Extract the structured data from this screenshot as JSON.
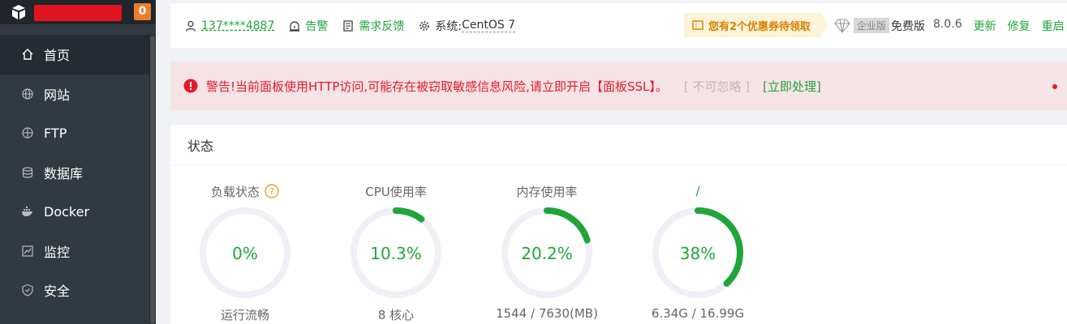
{
  "sidebar": {
    "badge": "0",
    "items": [
      {
        "label": "首页",
        "icon": "home-icon",
        "active": true
      },
      {
        "label": "网站",
        "icon": "globe-icon"
      },
      {
        "label": "FTP",
        "icon": "ftp-icon"
      },
      {
        "label": "数据库",
        "icon": "database-icon"
      },
      {
        "label": "Docker",
        "icon": "docker-icon"
      },
      {
        "label": "监控",
        "icon": "monitor-icon"
      },
      {
        "label": "安全",
        "icon": "shield-icon"
      }
    ]
  },
  "topbar": {
    "user": "137****4887",
    "alarm": "告警",
    "feedback": "需求反馈",
    "system_label": "系统:",
    "system_value": "CentOS 7",
    "coupon": "您有2个优惠券待领取",
    "enterprise": "企业版",
    "free": "免费版",
    "version": "8.0.6",
    "update": "更新",
    "repair": "修复",
    "restart": "重启"
  },
  "alert": {
    "message": "警告!当前面板使用HTTP访问,可能存在被窃取敏感信息风险,请立即开启【面板SSL】。",
    "ignore": "[ 不可忽略 ]",
    "fix": "[立即处理]"
  },
  "status": {
    "title": "状态",
    "gauges": [
      {
        "label": "负载状态",
        "value_text": "0%",
        "value": 0,
        "sub": "运行流畅",
        "help": true
      },
      {
        "label": "CPU使用率",
        "value_text": "10.3%",
        "value": 10.3,
        "sub": "8 核心"
      },
      {
        "label": "内存使用率",
        "value_text": "20.2%",
        "value": 20.2,
        "sub": "1544 / 7630(MB)"
      },
      {
        "label": "/",
        "value_text": "38%",
        "value": 38,
        "sub": "6.34G / 16.99G",
        "label_green": true
      }
    ]
  },
  "colors": {
    "accent": "#20a53a",
    "danger": "#e01c2b",
    "sidebar": "#313a42"
  }
}
